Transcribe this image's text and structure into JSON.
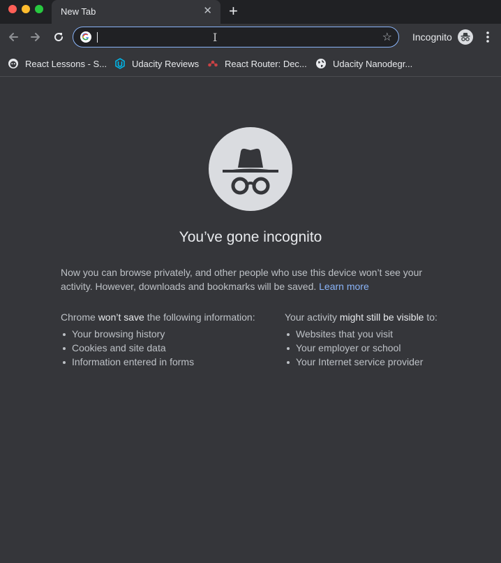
{
  "window": {
    "controls": {
      "close_color": "#ff5f57",
      "minimize_color": "#febc2e",
      "zoom_color": "#28c840"
    }
  },
  "tabs": [
    {
      "title": "New Tab",
      "close_icon": "close-icon",
      "active": true
    }
  ],
  "new_tab_icon": "plus-icon",
  "toolbar": {
    "back_icon": "arrow-left-icon",
    "forward_icon": "arrow-right-icon",
    "reload_icon": "reload-icon",
    "omnibox": {
      "value": "",
      "icon": "google-g-icon",
      "bookmark_icon": "star-icon"
    },
    "profile_label": "Incognito",
    "profile_icon": "incognito-icon",
    "menu_icon": "more-vert-icon"
  },
  "bookmarks": [
    {
      "label": "React Lessons - S...",
      "icon": "monkey-favicon"
    },
    {
      "label": "Udacity Reviews",
      "icon": "udacity-favicon"
    },
    {
      "label": "React Router: Dec...",
      "icon": "react-router-favicon"
    },
    {
      "label": "Udacity Nanodegr...",
      "icon": "globe-icon"
    }
  ],
  "page": {
    "hero_icon": "incognito-icon",
    "heading": "You’ve gone incognito",
    "intro": "Now you can browse privately, and other people who use this device won’t see your activity. However, downloads and bookmarks will be saved.",
    "learn_more": "Learn more",
    "left_column": {
      "prefix": "Chrome",
      "emphasis": "won’t save",
      "suffix": "the following information:",
      "items": [
        "Your browsing history",
        "Cookies and site data",
        "Information entered in forms"
      ]
    },
    "right_column": {
      "prefix": "Your activity",
      "emphasis": "might still be visible",
      "suffix": "to:",
      "items": [
        "Websites that you visit",
        "Your employer or school",
        "Your Internet service provider"
      ]
    }
  },
  "colors": {
    "background": "#35363a",
    "titlebar": "#202124",
    "accent": "#8ab4f8",
    "text": "#e8eaed",
    "muted_text": "#bdc1c6"
  }
}
